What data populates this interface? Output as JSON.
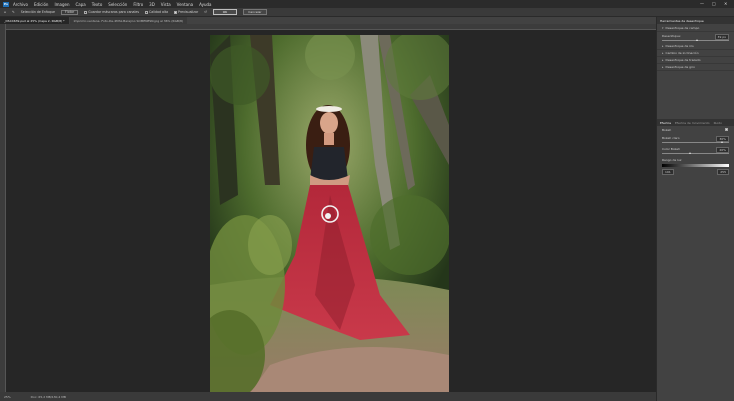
{
  "menubar": {
    "logo": "Ps",
    "items": [
      "Archivo",
      "Edición",
      "Imagen",
      "Capa",
      "Texto",
      "Selección",
      "Filtro",
      "3D",
      "Vista",
      "Ventana",
      "Ayuda"
    ],
    "controls": [
      "—",
      "□",
      "✕"
    ]
  },
  "optionsbar": {
    "focus_label": "Selección de Enfoque",
    "focus_value": "Flotar",
    "save_masks_label": "Guardar máscaras para canales",
    "quality_label": "Calidad alta",
    "preview_label": "Previsualizar",
    "ok_label": "OK",
    "cancel_label": "Cancelar"
  },
  "tabs": [
    {
      "label": "_DSC4639.psd al 25% (Capa 2, RGB/8) *",
      "active": true
    },
    {
      "label": "Imprimir-ventana. Foto-De-4Mhz-Barajino SOMENESN.jpg al 36% (RGB/8)",
      "active": false
    }
  ],
  "status": {
    "zoom": "25%",
    "doc": "Doc: 65,2 MB/130,4 MB"
  },
  "panel": {
    "title": "Herramientas de desenfoque",
    "field_blur": {
      "label": "Desenfoque de campo",
      "sub_label": "Desenfoque:",
      "value": "39 px"
    },
    "collapsed_sections": [
      "Desenfoque de iris",
      "Cambio de inclinación",
      "Desenfoque de trazado",
      "Desenfoque de giro"
    ],
    "effects_tabs": [
      "Efectos",
      "Efectos de movimiento",
      "Ruido"
    ],
    "bokeh_label": "Bokeh",
    "light_bokeh": {
      "label": "Bokeh claro",
      "value": "30%"
    },
    "bokeh_color": {
      "label": "Color Bokeh",
      "value": "20%"
    },
    "light_range": {
      "label": "Rango de luz",
      "min": "191",
      "max": "255"
    }
  }
}
